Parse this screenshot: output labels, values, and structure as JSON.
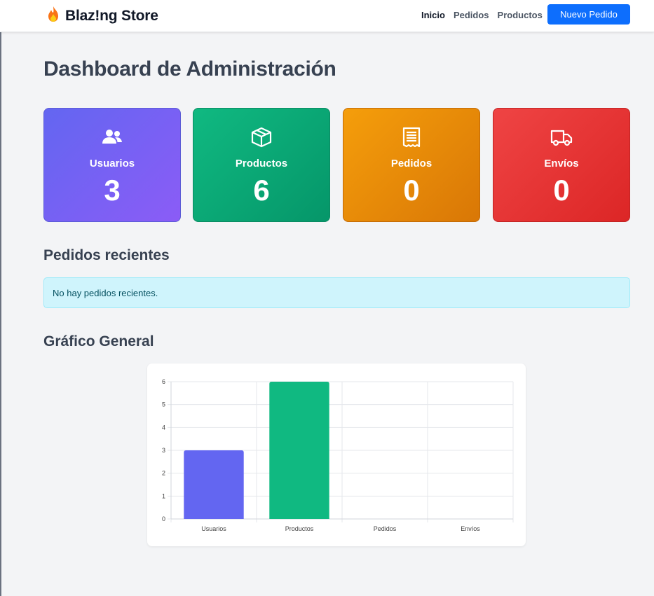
{
  "navbar": {
    "brand": "Blaz!ng Store",
    "links": [
      "Inicio",
      "Pedidos",
      "Productos"
    ],
    "cta": "Nuevo Pedido"
  },
  "page": {
    "title": "Dashboard de Administración"
  },
  "stats": [
    {
      "label": "Usuarios",
      "value": "3",
      "icon": "users-icon",
      "color": "#6366f1"
    },
    {
      "label": "Productos",
      "value": "6",
      "icon": "box-icon",
      "color": "#10b981"
    },
    {
      "label": "Pedidos",
      "value": "0",
      "icon": "receipt-icon",
      "color": "#f59e0b"
    },
    {
      "label": "Envíos",
      "value": "0",
      "icon": "truck-icon",
      "color": "#ef4444"
    }
  ],
  "recent_orders": {
    "title": "Pedidos recientes",
    "empty_message": "No hay pedidos recientes."
  },
  "chart_section": {
    "title": "Gráfico General"
  },
  "chart_data": {
    "type": "bar",
    "categories": [
      "Usuarios",
      "Productos",
      "Pedidos",
      "Envíos"
    ],
    "values": [
      3,
      6,
      0,
      0
    ],
    "colors": [
      "#6366f1",
      "#10b981",
      "#f59e0b",
      "#ef4444"
    ],
    "ylim": [
      0,
      6
    ],
    "yticks": [
      0,
      1,
      2,
      3,
      4,
      5,
      6
    ],
    "grid": true,
    "legend": "none"
  }
}
